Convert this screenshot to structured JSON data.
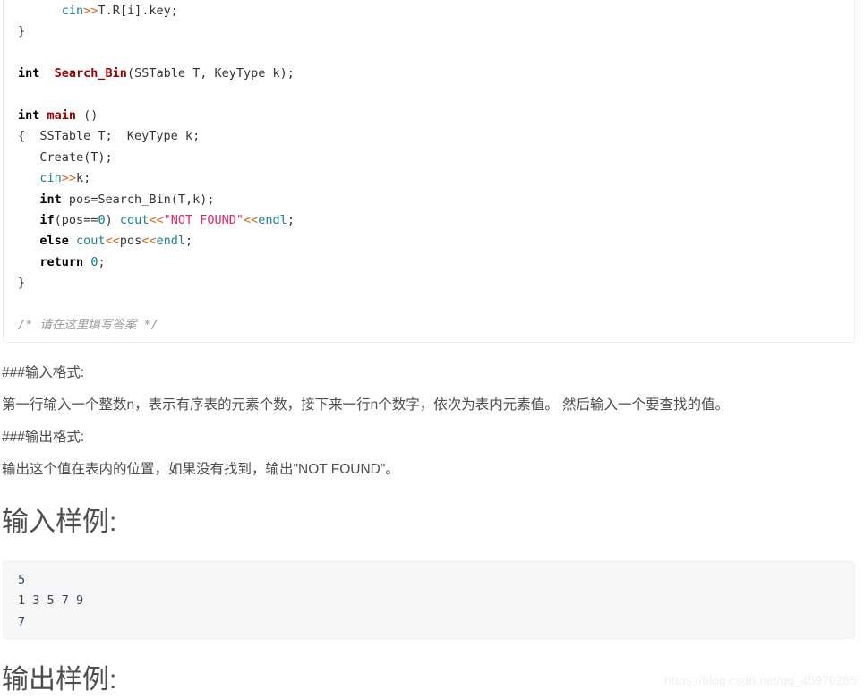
{
  "code_block": {
    "language": "cpp",
    "lines": [
      [
        {
          "t": "      ",
          "c": "plain"
        },
        {
          "t": "cin",
          "c": "io"
        },
        {
          "t": ">>",
          "c": "op"
        },
        {
          "t": "T.R[i].key;",
          "c": "plain"
        }
      ],
      [
        {
          "t": "}",
          "c": "plain"
        }
      ],
      [],
      [
        {
          "t": "int",
          "c": "kw"
        },
        {
          "t": "  ",
          "c": "plain"
        },
        {
          "t": "Search_Bin",
          "c": "fn"
        },
        {
          "t": "(SSTable T, KeyType k);",
          "c": "plain"
        }
      ],
      [],
      [
        {
          "t": "int",
          "c": "kw"
        },
        {
          "t": " ",
          "c": "plain"
        },
        {
          "t": "main",
          "c": "fn"
        },
        {
          "t": " ()",
          "c": "plain"
        }
      ],
      [
        {
          "t": "{  SSTable T;  KeyType k;",
          "c": "plain"
        }
      ],
      [
        {
          "t": "   Create(T);",
          "c": "plain"
        }
      ],
      [
        {
          "t": "   ",
          "c": "plain"
        },
        {
          "t": "cin",
          "c": "io"
        },
        {
          "t": ">>",
          "c": "op"
        },
        {
          "t": "k;",
          "c": "plain"
        }
      ],
      [
        {
          "t": "   ",
          "c": "plain"
        },
        {
          "t": "int",
          "c": "kw"
        },
        {
          "t": " pos=Search_Bin(T,k);",
          "c": "plain"
        }
      ],
      [
        {
          "t": "   ",
          "c": "plain"
        },
        {
          "t": "if",
          "c": "kw"
        },
        {
          "t": "(pos==",
          "c": "plain"
        },
        {
          "t": "0",
          "c": "num"
        },
        {
          "t": ") ",
          "c": "plain"
        },
        {
          "t": "cout",
          "c": "io"
        },
        {
          "t": "<<",
          "c": "op"
        },
        {
          "t": "\"NOT FOUND\"",
          "c": "str"
        },
        {
          "t": "<<",
          "c": "op"
        },
        {
          "t": "endl",
          "c": "io"
        },
        {
          "t": ";",
          "c": "plain"
        }
      ],
      [
        {
          "t": "   ",
          "c": "plain"
        },
        {
          "t": "else",
          "c": "kw"
        },
        {
          "t": " ",
          "c": "plain"
        },
        {
          "t": "cout",
          "c": "io"
        },
        {
          "t": "<<",
          "c": "op"
        },
        {
          "t": "pos",
          "c": "plain"
        },
        {
          "t": "<<",
          "c": "op"
        },
        {
          "t": "endl",
          "c": "io"
        },
        {
          "t": ";",
          "c": "plain"
        }
      ],
      [
        {
          "t": "   ",
          "c": "plain"
        },
        {
          "t": "return",
          "c": "kw"
        },
        {
          "t": " ",
          "c": "plain"
        },
        {
          "t": "0",
          "c": "num"
        },
        {
          "t": ";",
          "c": "plain"
        }
      ],
      [
        {
          "t": "}",
          "c": "plain"
        }
      ],
      [],
      [
        {
          "t": "/* 请在这里填写答案 */",
          "c": "cmt"
        }
      ]
    ]
  },
  "sections": {
    "input_format_heading": "###输入格式:",
    "input_format_text": "第一行输入一个整数n，表示有序表的元素个数，接下来一行n个数字，依次为表内元素值。 然后输入一个要查找的值。",
    "output_format_heading": "###输出格式:",
    "output_format_text": "输出这个值在表内的位置，如果没有找到，输出\"NOT FOUND\"。",
    "input_sample_heading": "输入样例:",
    "output_sample_heading": "输出样例:"
  },
  "input_sample": {
    "lines": [
      "5",
      "1 3 5 7 9",
      "7"
    ]
  },
  "watermark": {
    "text": "https://blog.csdn.net/qq_45970285"
  },
  "colors": {
    "keyword": "#000000",
    "function": "#990000",
    "stream": "#1a7f8e",
    "operator": "#d2691e",
    "string": "#e0245e",
    "number": "#008080",
    "comment": "#999999",
    "body_text": "#4d4d4d",
    "sample_bg": "#f7f7f7",
    "watermark": "#f0f0f0"
  }
}
